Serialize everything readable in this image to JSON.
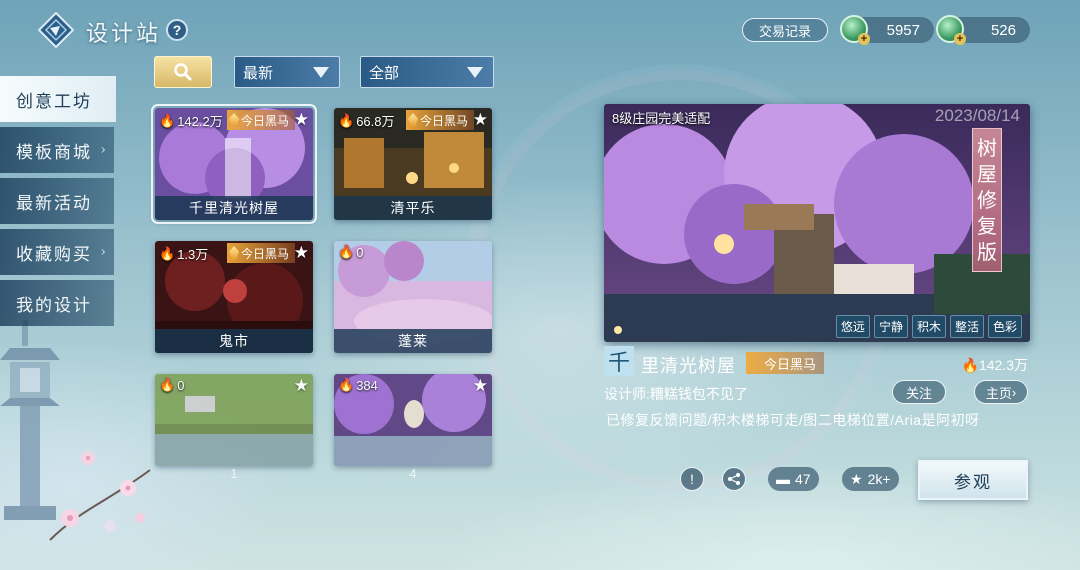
{
  "header": {
    "title": "设计站",
    "help_icon": "?",
    "trade_record": "交易记录",
    "currency_1": "5957",
    "currency_2": "526"
  },
  "nav": {
    "items": [
      {
        "label": "创意工坊"
      },
      {
        "label": "模板商城"
      },
      {
        "label": "最新活动"
      },
      {
        "label": "收藏购买"
      },
      {
        "label": "我的设计"
      }
    ]
  },
  "filters": {
    "sort": "最新",
    "category": "全部"
  },
  "cards": [
    {
      "title": "千里清光树屋",
      "popularity": "142.2万",
      "badge": "今日黑马"
    },
    {
      "title": "清平乐",
      "popularity": "66.8万",
      "badge": "今日黑马"
    },
    {
      "title": "鬼市",
      "popularity": "1.3万",
      "badge": "今日黑马"
    },
    {
      "title": "蓬莱",
      "popularity": "0",
      "badge": ""
    },
    {
      "title": "",
      "popularity": "0",
      "badge": "",
      "page": "1"
    },
    {
      "title": "",
      "popularity": "384",
      "badge": "",
      "page": "4"
    }
  ],
  "featured": {
    "caption": "8级庄园完美适配",
    "date": "2023/08/14",
    "vertical_title": "树屋修复版",
    "tags": [
      "悠远",
      "宁静",
      "积木",
      "整活",
      "色彩"
    ],
    "icon_char": "千",
    "name": "里清光树屋",
    "badge": "今日黑马",
    "popularity": "142.3万",
    "designer": "设计师:糟糕钱包不见了",
    "follow_label": "关注",
    "homepage_label": "主页",
    "description": "已修复反馈问题/积木楼梯可走/图二电梯位置/Aria是阿初呀",
    "comments": "47",
    "favorites": "2k+",
    "visit_label": "参观"
  },
  "colors": {
    "accent_gold": "#d9b868",
    "panel_blue": "#2a5a86",
    "badge_orange": "#f0aa3c"
  }
}
